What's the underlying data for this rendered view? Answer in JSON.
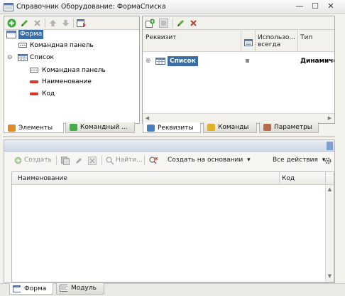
{
  "window": {
    "title": "Справочник Оборудование: ФормаСписка",
    "minimize_glyph": "—",
    "restore_glyph": "☐",
    "close_glyph": "✕"
  },
  "elements_pane": {
    "tree": {
      "root": "Форма",
      "root_child": "Командная панель",
      "list": "Список",
      "list_children": [
        "Командная панель",
        "Наименование",
        "Код"
      ],
      "toggle_glyph": "⊖"
    },
    "tabs": [
      "Элементы",
      "Командный ..."
    ]
  },
  "attributes_pane": {
    "columns": {
      "attribute": "Реквизит",
      "use_always_line1": "Использо...",
      "use_always_line2": "всегда",
      "type": "Тип"
    },
    "row": {
      "name": "Список",
      "type": "Динамическ",
      "expand_glyph": "⊕"
    },
    "tabs": [
      "Реквизиты",
      "Команды",
      "Параметры"
    ]
  },
  "preview": {
    "toolbar": {
      "create": "Создать",
      "find": "Найти...",
      "create_based_on": "Создать на основании",
      "all_actions": "Все действия",
      "dropdown_glyph": "▾"
    },
    "columns": [
      "Наименование",
      "Код"
    ]
  },
  "bottom_tabs": [
    "Форма",
    "Модуль"
  ],
  "scroll_glyphs": {
    "up": "▲",
    "down": "▼",
    "left": "◀",
    "right": "▶"
  },
  "colors": {
    "accent_blue": "#3d6fb6",
    "add_green": "#3aa83a",
    "delete_red": "#d23a2a",
    "selection_blue": "#3a6ea5",
    "panel_background": "#f4f2ec"
  }
}
